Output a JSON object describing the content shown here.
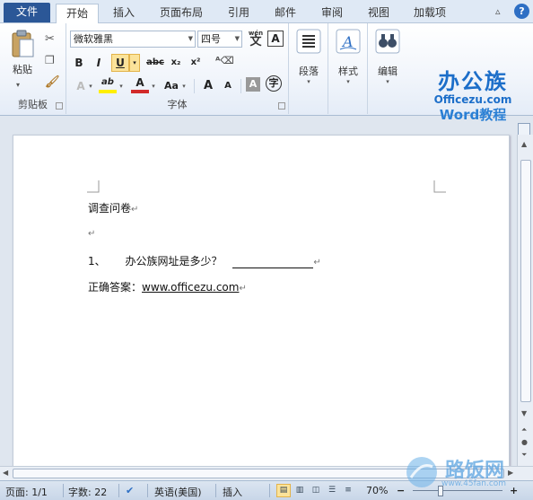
{
  "tabs": [
    {
      "label": "文件"
    },
    {
      "label": "开始"
    },
    {
      "label": "插入"
    },
    {
      "label": "页面布局"
    },
    {
      "label": "引用"
    },
    {
      "label": "邮件"
    },
    {
      "label": "审阅"
    },
    {
      "label": "视图"
    },
    {
      "label": "加载项"
    }
  ],
  "ribbon": {
    "clipboard": {
      "paste": "粘贴",
      "group": "剪贴板"
    },
    "font": {
      "name": "微软雅黑",
      "size": "四号",
      "wen": "wén",
      "wen_char": "文",
      "box_a": "A",
      "bold": "B",
      "italic": "I",
      "underline": "U",
      "strike": "abc",
      "sub": "x₂",
      "sup": "x²",
      "effects": "A",
      "highlight": "ab",
      "color": "A",
      "case": "Aa",
      "grow": "A",
      "shrink": "A",
      "shade": "A",
      "enclose": "字",
      "group": "字体"
    },
    "paragraph": {
      "label": "段落"
    },
    "styles": {
      "label": "样式"
    },
    "editing": {
      "label": "编辑"
    }
  },
  "logo": {
    "line1": "办公族",
    "line2": "Officezu.com",
    "line3": "Word教程"
  },
  "document": {
    "title": "调查问卷",
    "q_num": "1、",
    "q_text": "办公族网址是多少？",
    "answer_label": "正确答案：",
    "answer_value": "www.officezu.com",
    "mark": "↵"
  },
  "status": {
    "page": "页面: 1/1",
    "words": "字数: 22",
    "lang": "英语(美国)",
    "mode": "插入",
    "zoom": "70%"
  },
  "watermark": {
    "text": "路饭网",
    "url": "www.45fan.com"
  },
  "colors": {
    "accent": "#2b5797",
    "highlight": "#fbe39a",
    "font_color": "#d22a2a",
    "highlight_color": "#ffef00"
  }
}
